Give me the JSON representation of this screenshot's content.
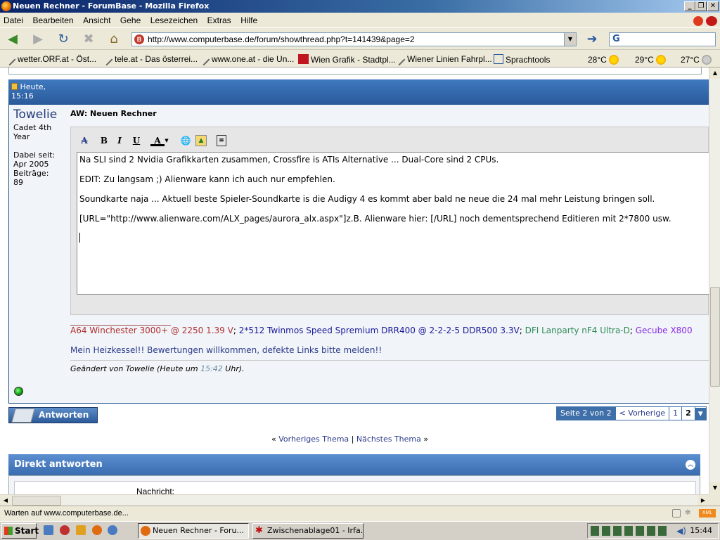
{
  "window": {
    "title": "Neuen Rechner - ForumBase - Mozilla Firefox",
    "min": "_",
    "max": "❐",
    "close": "✕"
  },
  "menu": [
    "Datei",
    "Bearbeiten",
    "Ansicht",
    "Gehe",
    "Lesezeichen",
    "Extras",
    "Hilfe"
  ],
  "toolbar": {
    "url": "http://www.computerbase.de/forum/showthread.php?t=141439&page=2",
    "search_placeholder": ""
  },
  "bookmarks": [
    "wetter.ORF.at - Öst...",
    "tele.at - Das österrei...",
    "www.one.at - die Un...",
    "Wien Grafik - Stadtpl...",
    "Wiener Linien Fahrpl...",
    "Sprachtools"
  ],
  "weather": [
    "28°C",
    "29°C",
    "27°C"
  ],
  "post": {
    "date": "Heute,",
    "time": "15:16",
    "username": "Towelie",
    "rank1": "Cadet 4th",
    "rank2": "Year",
    "joined_label": "Dabei seit:",
    "joined": "Apr 2005",
    "posts_label": "Beiträge:",
    "posts": "89",
    "title": "AW: Neuen Rechner",
    "lines": [
      "Na SLI sind 2 Nvidia Grafikkarten zusammen, Crossfire is ATIs Alternative ... Dual-Core sind 2 CPUs.",
      "EDIT: Zu langsam ;) Alienware kann ich auch nur empfehlen.",
      "Soundkarte naja ... Aktuell beste Spieler-Soundkarte is die Audigy 4 es kommt aber bald ne neue die 24 mal mehr Leistung bringen soll.",
      "[URL=\"http://www.alienware.com/ALX_pages/aurora_alx.aspx\"]z.B. Alienware hier: [/URL] noch dementsprechend Editieren mit 2*7800 usw."
    ],
    "sig": {
      "part1": "A64 Winchester 3000+ @ 2250 1.39 V",
      "sep1": "; ",
      "part2": "2*512 Twinmos Speed Spremium DRR400 @ 2-2-2-5 DDR500 3.3V",
      "sep2": "; ",
      "part3": "DFI Lanparty nF4 Ultra-D",
      "sep3": "; ",
      "part4": "Gecube X800",
      "line2": "Mein Heizkessel!! Bewertungen willkommen, defekte Links bitte melden!!"
    },
    "edited_prefix": "Geändert von Towelie (Heute um ",
    "edited_time": "15:42",
    "edited_suffix": " Uhr)."
  },
  "colors": {
    "sig1": "#b03030",
    "sig2": "#1a1a9a",
    "sig3": "#2e8b57",
    "sig4": "#8a2be2",
    "link": "#2a3a8a"
  },
  "actions": {
    "answer": "Antworten"
  },
  "pager": {
    "label": "Seite 2 von 2",
    "prev": "< Vorherige",
    "p1": "1",
    "p2": "2"
  },
  "threadnav": {
    "lq": "«",
    "prev": "Vorheriges Thema",
    "sep": "|",
    "next": "Nächstes Thema",
    "rq": "»"
  },
  "direct": {
    "title": "Direkt antworten",
    "field": "Nachricht:"
  },
  "status": "Warten auf www.computerbase.de...",
  "taskbar": {
    "start": "Start",
    "task1": "Neuen Rechner - Foru...",
    "task2": "Zwischenablage01 - Irfa...",
    "clock": "15:44"
  }
}
